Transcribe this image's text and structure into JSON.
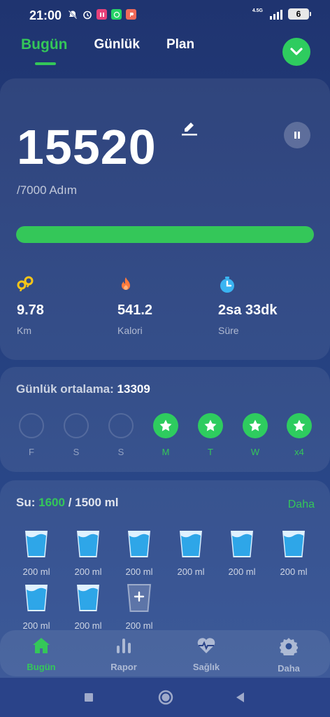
{
  "status_bar": {
    "time": "21:00",
    "network": "4.5G",
    "battery": "6"
  },
  "top_tabs": [
    {
      "label": "Bugün",
      "active": true
    },
    {
      "label": "Günlük",
      "active": false
    },
    {
      "label": "Plan",
      "active": false
    }
  ],
  "steps": {
    "value": "15520",
    "goal": "/7000 Adım",
    "progress_fraction": 1.0
  },
  "stats": [
    {
      "value": "9.78",
      "label": "Km",
      "icon": "distance-icon",
      "color": "#f5c518"
    },
    {
      "value": "541.2",
      "label": "Kalori",
      "icon": "flame-icon",
      "color": "#ff7a3d"
    },
    {
      "value": "2sa 33dk",
      "label": "Süre",
      "icon": "clock-icon",
      "color": "#3ab4f2"
    }
  ],
  "daily_average": {
    "label": "Günlük ortalama:",
    "value": "13309",
    "days": [
      {
        "label": "F",
        "done": false
      },
      {
        "label": "S",
        "done": false
      },
      {
        "label": "S",
        "done": false
      },
      {
        "label": "M",
        "done": true
      },
      {
        "label": "T",
        "done": true
      },
      {
        "label": "W",
        "done": true
      },
      {
        "label": "x4",
        "done": true
      }
    ]
  },
  "water": {
    "prefix": "Su:",
    "value": "1600",
    "suffix": "/ 1500 ml",
    "more": "Daha",
    "glasses": [
      {
        "label": "200 ml",
        "filled": true
      },
      {
        "label": "200 ml",
        "filled": true
      },
      {
        "label": "200 ml",
        "filled": true
      },
      {
        "label": "200 ml",
        "filled": true
      },
      {
        "label": "200 ml",
        "filled": true
      },
      {
        "label": "200 ml",
        "filled": true
      },
      {
        "label": "200 ml",
        "filled": true
      },
      {
        "label": "200 ml",
        "filled": true
      },
      {
        "label": "200 ml",
        "filled": false
      }
    ]
  },
  "bottom_nav": [
    {
      "label": "Bugün",
      "icon": "home-icon",
      "active": true
    },
    {
      "label": "Rapor",
      "icon": "bar-chart-icon",
      "active": false
    },
    {
      "label": "Sağlık",
      "icon": "heart-pulse-icon",
      "active": false
    },
    {
      "label": "Daha",
      "icon": "gear-icon",
      "active": false
    }
  ],
  "colors": {
    "accent": "#34c759",
    "background": "#24397a"
  }
}
